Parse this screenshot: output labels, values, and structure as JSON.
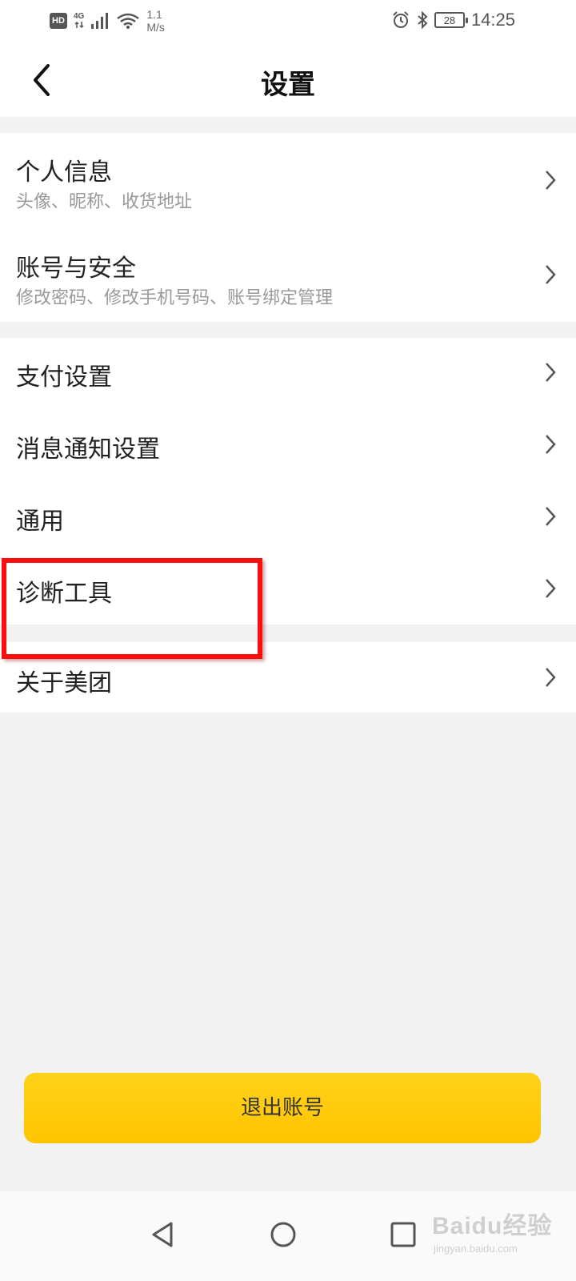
{
  "status_bar": {
    "hd": "HD",
    "network": "4G",
    "speed_value": "1.1",
    "speed_unit": "M/s",
    "battery": "28",
    "time": "14:25"
  },
  "header": {
    "title": "设置",
    "back_icon": "chevron-left-icon"
  },
  "settings": {
    "personal_info": {
      "title": "个人信息",
      "subtitle": "头像、昵称、收货地址"
    },
    "account_security": {
      "title": "账号与安全",
      "subtitle": "修改密码、修改手机号码、账号绑定管理"
    },
    "payment": {
      "title": "支付设置"
    },
    "notifications": {
      "title": "消息通知设置"
    },
    "general": {
      "title": "通用"
    },
    "diagnostics": {
      "title": "诊断工具"
    },
    "about": {
      "title": "关于美团"
    }
  },
  "logout": {
    "label": "退出账号"
  },
  "watermark": {
    "main": "Baidu经验",
    "sub": "jingyan.baidu.com"
  },
  "colors": {
    "accent": "#ffc400",
    "highlight": "#ff0d0d",
    "background": "#f2f2f2"
  }
}
